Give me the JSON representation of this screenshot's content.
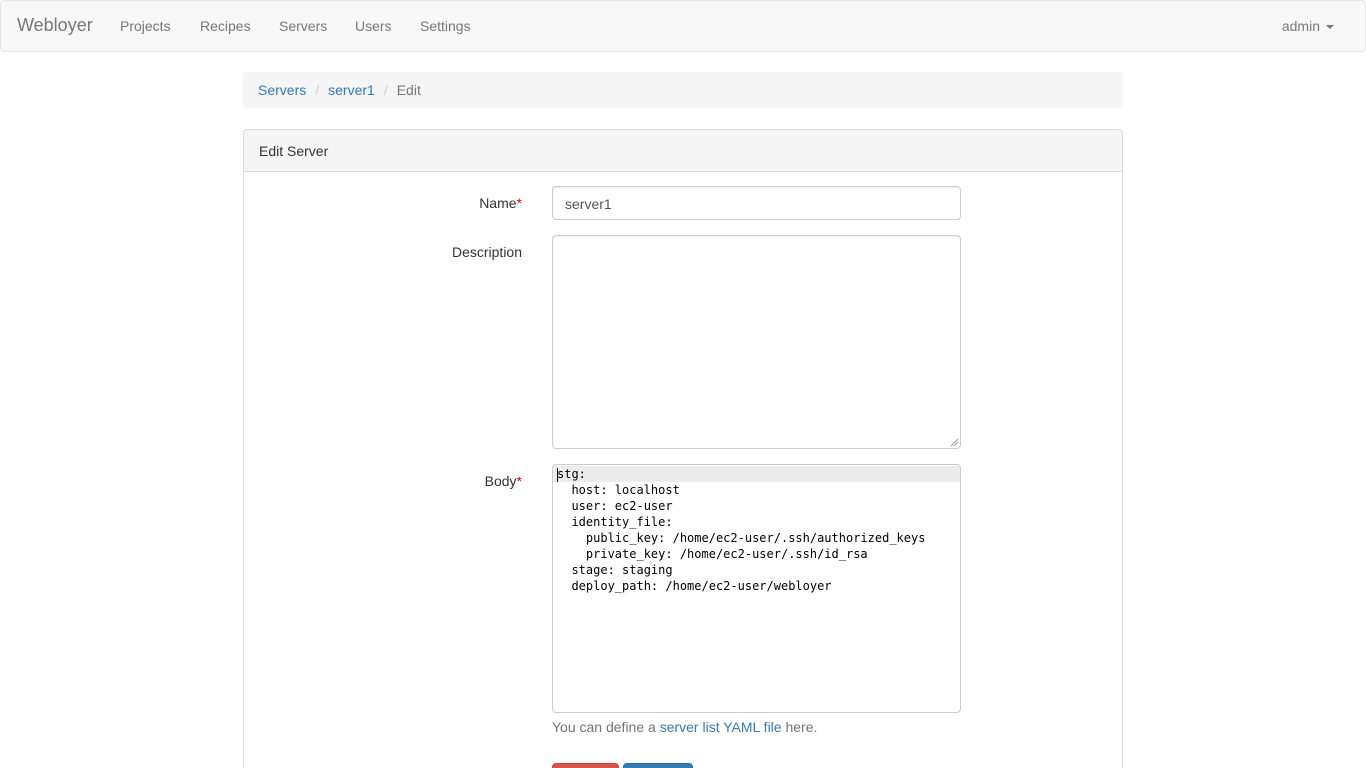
{
  "navbar": {
    "brand": "Webloyer",
    "items": [
      "Projects",
      "Recipes",
      "Servers",
      "Users",
      "Settings"
    ],
    "user": "admin"
  },
  "breadcrumb": {
    "items": [
      "Servers",
      "server1"
    ],
    "active": "Edit",
    "separator": "/"
  },
  "panel": {
    "title": "Edit Server"
  },
  "form": {
    "name_label": "Name",
    "name_value": "server1",
    "description_label": "Description",
    "description_value": "",
    "body_label": "Body",
    "required_mark": "*",
    "body_lines": [
      "stg:",
      "  host: localhost",
      "  user: ec2-user",
      "  identity_file:",
      "    public_key: /home/ec2-user/.ssh/authorized_keys",
      "    private_key: /home/ec2-user/.ssh/id_rsa",
      "  stage: staging",
      "  deploy_path: /home/ec2-user/webloyer"
    ],
    "help_prefix": "You can define a ",
    "help_link": "server list YAML file",
    "help_suffix": " here."
  },
  "buttons": {
    "cancel": "",
    "submit": ""
  },
  "colors": {
    "link": "#337ab7",
    "danger": "#d9534f",
    "primary": "#337ab7",
    "required": "#e00000"
  }
}
